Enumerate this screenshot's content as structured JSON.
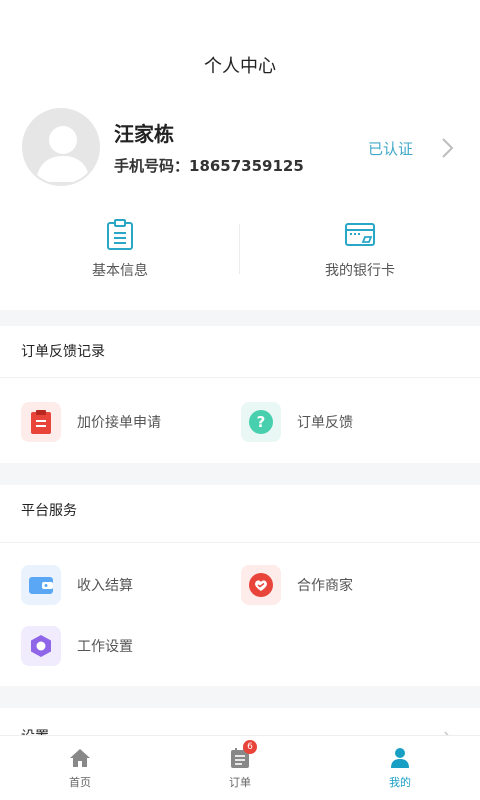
{
  "header": {
    "title": "个人中心"
  },
  "profile": {
    "name": "汪家栋",
    "phone": "手机号码：18657359125",
    "verified_label": "已认证"
  },
  "quick_actions": [
    {
      "label": "基本信息",
      "icon": "clipboard-icon"
    },
    {
      "label": "我的银行卡",
      "icon": "bank-card-icon"
    }
  ],
  "order_feedback": {
    "title": "订单反馈记录",
    "items": [
      {
        "label": "加价接单申请",
        "icon": "clipboard-red-icon",
        "color": "#e8443a"
      },
      {
        "label": "订单反馈",
        "icon": "question-icon",
        "color": "#48cfae"
      }
    ]
  },
  "platform_services": {
    "title": "平台服务",
    "items": [
      {
        "label": "收入结算",
        "icon": "wallet-icon",
        "color": "#5aa8f5"
      },
      {
        "label": "合作商家",
        "icon": "handshake-heart-icon",
        "color": "#e8443a"
      },
      {
        "label": "工作设置",
        "icon": "hexagon-gear-icon",
        "color": "#8f66e8"
      }
    ]
  },
  "settings": {
    "label": "设置"
  },
  "tabbar": {
    "tabs": [
      {
        "label": "首页",
        "icon": "home-icon"
      },
      {
        "label": "订单",
        "icon": "order-list-icon",
        "badge": "6"
      },
      {
        "label": "我的",
        "icon": "person-icon"
      }
    ],
    "active_color": "#1a9fc4"
  }
}
